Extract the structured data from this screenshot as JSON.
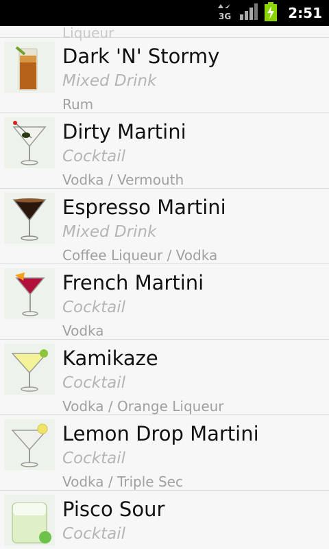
{
  "status_bar": {
    "network": "3G",
    "time": "2:51",
    "battery_color": "#8bd400"
  },
  "partial_top": {
    "label": "Liqueur"
  },
  "drinks": [
    {
      "name": "Dark 'N' Stormy",
      "type": "Mixed Drink",
      "ingredients": "Rum",
      "icon": "highball-glass-icon"
    },
    {
      "name": "Dirty Martini",
      "type": "Cocktail",
      "ingredients": "Vodka / Vermouth",
      "icon": "martini-olive-icon"
    },
    {
      "name": "Espresso Martini",
      "type": "Mixed Drink",
      "ingredients": "Coffee Liqueur / Vodka",
      "icon": "espresso-martini-icon"
    },
    {
      "name": "French Martini",
      "type": "Cocktail",
      "ingredients": "Vodka",
      "icon": "french-martini-icon"
    },
    {
      "name": "Kamikaze",
      "type": "Cocktail",
      "ingredients": "Vodka / Orange Liqueur",
      "icon": "kamikaze-icon"
    },
    {
      "name": "Lemon Drop Martini",
      "type": "Cocktail",
      "ingredients": "Vodka / Triple Sec",
      "icon": "lemon-drop-icon"
    },
    {
      "name": "Pisco Sour",
      "type": "Cocktail",
      "ingredients": "",
      "icon": "pisco-sour-icon"
    }
  ]
}
